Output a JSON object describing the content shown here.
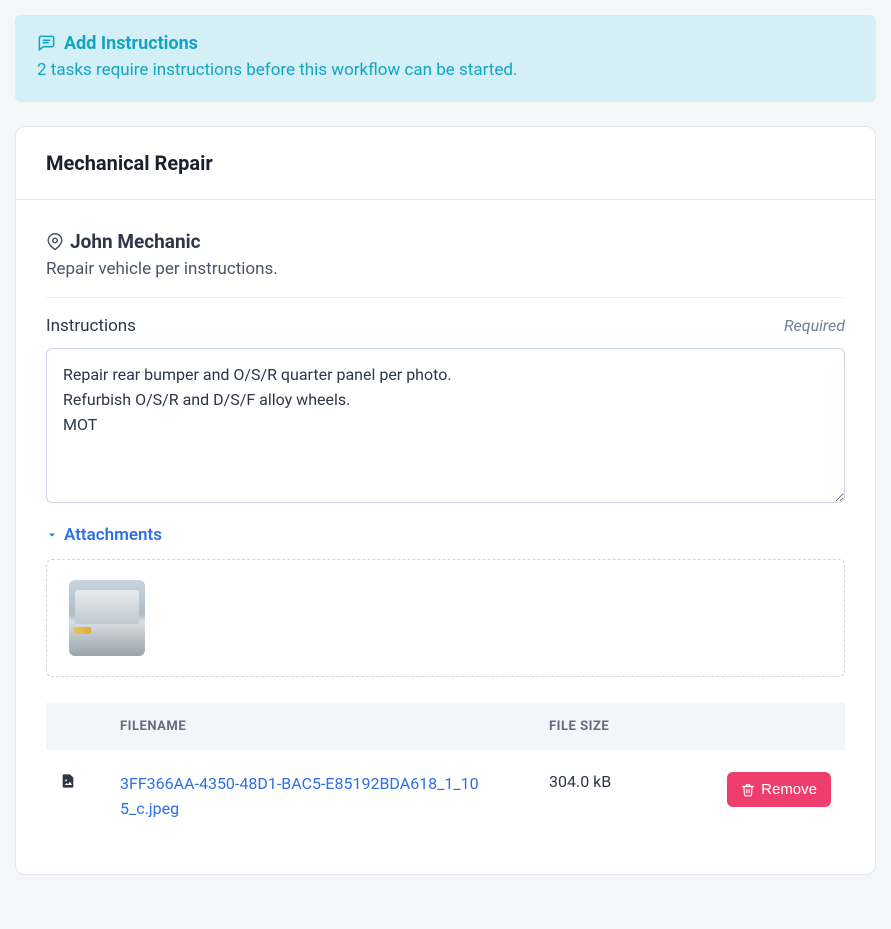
{
  "banner": {
    "title": "Add Instructions",
    "subtitle": "2 tasks require instructions before this workflow can be started."
  },
  "card": {
    "title": "Mechanical Repair",
    "assignee": "John Mechanic",
    "task_description": "Repair vehicle per instructions.",
    "instructions_label": "Instructions",
    "instructions_required": "Required",
    "instructions_value": "Repair rear bumper and O/S/R quarter panel per photo.\nRefurbish O/S/R and D/S/F alloy wheels.\nMOT",
    "attachments_label": "Attachments"
  },
  "files": {
    "headers": {
      "filename": "FILENAME",
      "filesize": "FILE SIZE"
    },
    "rows": [
      {
        "filename": "3FF366AA-4350-48D1-BAC5-E85192BDA618_1_105_c.jpeg",
        "filesize": "304.0 kB"
      }
    ],
    "remove_label": "Remove"
  }
}
